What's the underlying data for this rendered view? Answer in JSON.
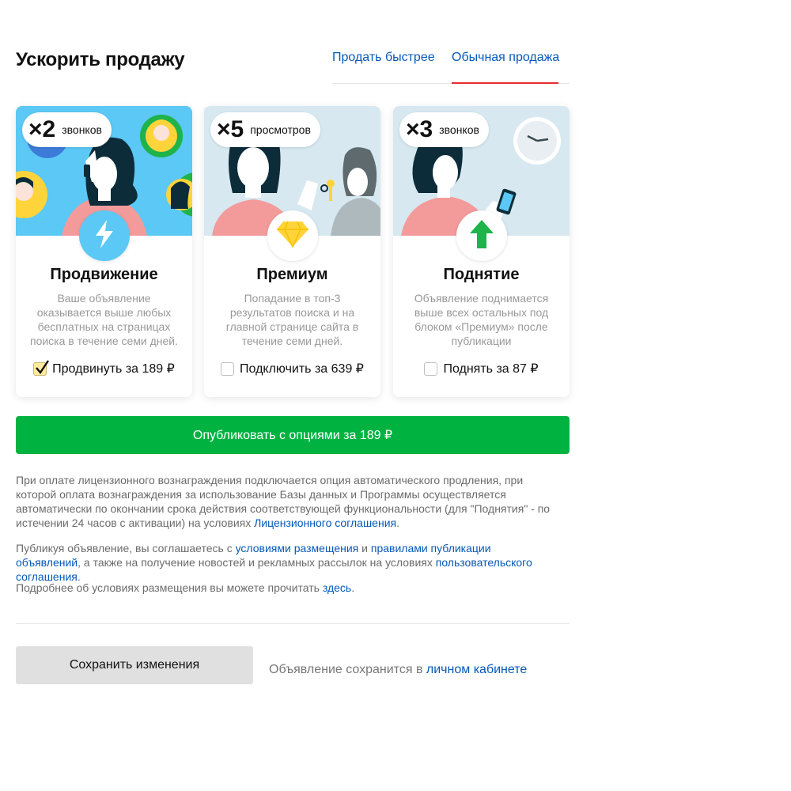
{
  "header": {
    "title": "Ускорить продажу",
    "tabs": [
      {
        "label": "Продать быстрее"
      },
      {
        "label": "Обычная продажа",
        "active": true
      }
    ]
  },
  "cards": [
    {
      "badge_mult": "×2",
      "badge_unit": "звонков",
      "title": "Продвижение",
      "description": "Ваше объявление оказывается выше любых бесплатных на страницах поиска в течение семи дней.",
      "option": "Продвинуть за 189 ₽",
      "checked": true,
      "icon": "lightning-icon"
    },
    {
      "badge_mult": "×5",
      "badge_unit": "просмотров",
      "title": "Премиум",
      "description": "Попадание в топ-3 результатов поиска и на главной странице сайта в течение семи дней.",
      "option": "Подключить за 639 ₽",
      "checked": false,
      "icon": "diamond-icon"
    },
    {
      "badge_mult": "×3",
      "badge_unit": "звонков",
      "title": "Поднятие",
      "description": "Объявление поднимается выше всех остальных под блоком «Премиум» после публикации",
      "option": "Поднять за 87 ₽",
      "checked": false,
      "icon": "arrow-up-icon"
    }
  ],
  "publish_button": "Опубликовать с опциями за 189 ₽",
  "legal": {
    "p1_text": "При оплате лицензионного вознаграждения подключается опция автоматического продления, при которой оплата вознаграждения за использование Базы данных и Программы осуществляется автоматически по окончании срока действия соответствующей функциональности (для \"Поднятия\" - по истечении 24 часов с активации) на условиях ",
    "p1_link": "Лицензионного соглашения",
    "p1_end": ".",
    "p2_text1": "Публикуя объявление, вы соглашаетесь с ",
    "p2_link1": "условиями размещения",
    "p2_text2": " и ",
    "p2_link2": "правилами публикации объявлений",
    "p2_text3": ", а также на получение новостей и рекламных рассылок на условиях ",
    "p2_link3": "пользовательского соглашения",
    "p2_end": ".",
    "p3_text": "Подробнее об условиях размещения вы можете прочитать ",
    "p3_link": "здесь",
    "p3_end": "."
  },
  "save_button": "Сохранить изменения",
  "save_note_text": "Объявление сохранится в ",
  "save_note_link": "личном кабинете",
  "colors": {
    "accent_green": "#00b341",
    "link_blue": "#0559b8",
    "tab_underline": "#e62d2d",
    "card1_bg": "#5bc8f5",
    "card2_bg": "#d7e8f0",
    "card3_bg": "#d7e8f0"
  }
}
